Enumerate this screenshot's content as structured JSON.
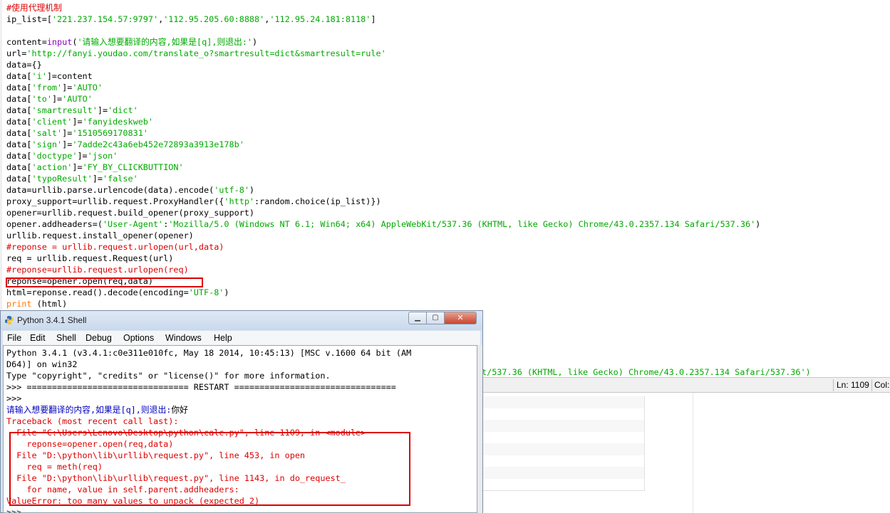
{
  "editor": {
    "lines": [
      [
        {
          "t": "#使用代理机制",
          "c": "c"
        }
      ],
      [
        {
          "t": "ip_list=[",
          "c": "k"
        },
        {
          "t": "'221.237.154.57:9797'",
          "c": "s"
        },
        {
          "t": ",",
          "c": "k"
        },
        {
          "t": "'112.95.205.60:8888'",
          "c": "s"
        },
        {
          "t": ",",
          "c": "k"
        },
        {
          "t": "'112.95.24.181:8118'",
          "c": "s"
        },
        {
          "t": "]",
          "c": "k"
        }
      ],
      [
        {
          "t": "",
          "c": "k"
        }
      ],
      [
        {
          "t": "content=",
          "c": "k"
        },
        {
          "t": "input",
          "c": "b"
        },
        {
          "t": "(",
          "c": "k"
        },
        {
          "t": "'请输入想要翻译的内容,如果是[q],则退出:'",
          "c": "s"
        },
        {
          "t": ")",
          "c": "k"
        }
      ],
      [
        {
          "t": "url=",
          "c": "k"
        },
        {
          "t": "'http://fanyi.youdao.com/translate_o?smartresult=dict&smartresult=rule'",
          "c": "s"
        }
      ],
      [
        {
          "t": "data={}",
          "c": "k"
        }
      ],
      [
        {
          "t": "data[",
          "c": "k"
        },
        {
          "t": "'i'",
          "c": "s"
        },
        {
          "t": "]=content",
          "c": "k"
        }
      ],
      [
        {
          "t": "data[",
          "c": "k"
        },
        {
          "t": "'from'",
          "c": "s"
        },
        {
          "t": "]=",
          "c": "k"
        },
        {
          "t": "'AUTO'",
          "c": "s"
        }
      ],
      [
        {
          "t": "data[",
          "c": "k"
        },
        {
          "t": "'to'",
          "c": "s"
        },
        {
          "t": "]=",
          "c": "k"
        },
        {
          "t": "'AUTO'",
          "c": "s"
        }
      ],
      [
        {
          "t": "data[",
          "c": "k"
        },
        {
          "t": "'smartresult'",
          "c": "s"
        },
        {
          "t": "]=",
          "c": "k"
        },
        {
          "t": "'dict'",
          "c": "s"
        }
      ],
      [
        {
          "t": "data[",
          "c": "k"
        },
        {
          "t": "'client'",
          "c": "s"
        },
        {
          "t": "]=",
          "c": "k"
        },
        {
          "t": "'fanyideskweb'",
          "c": "s"
        }
      ],
      [
        {
          "t": "data[",
          "c": "k"
        },
        {
          "t": "'salt'",
          "c": "s"
        },
        {
          "t": "]=",
          "c": "k"
        },
        {
          "t": "'1510569170831'",
          "c": "s"
        }
      ],
      [
        {
          "t": "data[",
          "c": "k"
        },
        {
          "t": "'sign'",
          "c": "s"
        },
        {
          "t": "]=",
          "c": "k"
        },
        {
          "t": "'7adde2c43a6eb452e72893a3913e178b'",
          "c": "s"
        }
      ],
      [
        {
          "t": "data[",
          "c": "k"
        },
        {
          "t": "'doctype'",
          "c": "s"
        },
        {
          "t": "]=",
          "c": "k"
        },
        {
          "t": "'json'",
          "c": "s"
        }
      ],
      [
        {
          "t": "data[",
          "c": "k"
        },
        {
          "t": "'action'",
          "c": "s"
        },
        {
          "t": "]=",
          "c": "k"
        },
        {
          "t": "'FY_BY_CLICKBUTTION'",
          "c": "s"
        }
      ],
      [
        {
          "t": "data[",
          "c": "k"
        },
        {
          "t": "'typoResult'",
          "c": "s"
        },
        {
          "t": "]=",
          "c": "k"
        },
        {
          "t": "'false'",
          "c": "s"
        }
      ],
      [
        {
          "t": "data=urllib.parse.urlencode(data).encode(",
          "c": "k"
        },
        {
          "t": "'utf-8'",
          "c": "s"
        },
        {
          "t": ")",
          "c": "k"
        }
      ],
      [
        {
          "t": "proxy_support=urllib.request.ProxyHandler({",
          "c": "k"
        },
        {
          "t": "'http'",
          "c": "s"
        },
        {
          "t": ":random.choice(ip_list)})",
          "c": "k"
        }
      ],
      [
        {
          "t": "opener=urllib.request.build_opener(proxy_support)",
          "c": "k"
        }
      ],
      [
        {
          "t": "opener.addheaders=(",
          "c": "k"
        },
        {
          "t": "'User-Agent'",
          "c": "s"
        },
        {
          "t": ":",
          "c": "k"
        },
        {
          "t": "'Mozilla/5.0 (Windows NT 6.1; Win64; x64) AppleWebKit/537.36 (KHTML, like Gecko) Chrome/43.0.2357.134 Safari/537.36'",
          "c": "s"
        },
        {
          "t": ")",
          "c": "k"
        }
      ],
      [
        {
          "t": "urllib.request.install_opener(opener)",
          "c": "k"
        }
      ],
      [
        {
          "t": "#reponse = urllib.request.urlopen(url,data)",
          "c": "c"
        }
      ],
      [
        {
          "t": "req = urllib.request.Request(url)",
          "c": "k"
        }
      ],
      [
        {
          "t": "#reponse=urllib.request.urlopen(req)",
          "c": "c"
        }
      ],
      [
        {
          "t": "reponse=opener.open(req,data)",
          "c": "k"
        }
      ],
      [
        {
          "t": "html=reponse.read().decode(encoding=",
          "c": "k"
        },
        {
          "t": "'UTF-8'",
          "c": "s"
        },
        {
          "t": ")",
          "c": "k"
        }
      ],
      [
        {
          "t": "print",
          "c": "kw"
        },
        {
          "t": " (html)",
          "c": "k"
        }
      ]
    ],
    "partial_line_text": "t/537.36 (KHTML, like Gecko) Chrome/43.0.2357.134 Safari/537.36')",
    "partial_line_tail": ")"
  },
  "status": {
    "ln": "Ln: 1109",
    "col": "Col:"
  },
  "shell": {
    "title": "Python 3.4.1 Shell",
    "buttons": {
      "min": "▁",
      "max": "▢",
      "close": "✕"
    },
    "menu": [
      "File",
      "Edit",
      "Shell",
      "Debug",
      "Options",
      "Windows",
      "Help"
    ],
    "lines": [
      {
        "t": "Python 3.4.1 (v3.4.1:c0e311e010fc, May 18 2014, 10:45:13) [MSC v.1600 64 bit (AM",
        "c": "blk"
      },
      {
        "t": "D64)] on win32",
        "c": "blk"
      },
      {
        "t": "Type \"copyright\", \"credits\" or \"license()\" for more information.",
        "c": "blk"
      },
      {
        "t": ">>> ================================ RESTART ================================",
        "c": "blk"
      },
      {
        "t": ">>> ",
        "c": "blk"
      },
      {
        "t": "请输入想要翻译的内容,如果是[q],则退出:",
        "c": "blue",
        "extra": "你好"
      },
      {
        "t": "Traceback (most recent call last):",
        "c": "red"
      },
      {
        "t": "  File \"C:\\Users\\Lenovo\\Desktop\\python\\calc.py\", line 1109, in <module>",
        "c": "red"
      },
      {
        "t": "    reponse=opener.open(req,data)",
        "c": "red"
      },
      {
        "t": "  File \"D:\\python\\lib\\urllib\\request.py\", line 453, in open",
        "c": "red"
      },
      {
        "t": "    req = meth(req)",
        "c": "red"
      },
      {
        "t": "  File \"D:\\python\\lib\\urllib\\request.py\", line 1143, in do_request_",
        "c": "red"
      },
      {
        "t": "    for name, value in self.parent.addheaders:",
        "c": "red"
      },
      {
        "t": "ValueError: too many values to unpack (expected 2)",
        "c": "red"
      },
      {
        "t": ">>> ",
        "c": "blk"
      }
    ]
  }
}
